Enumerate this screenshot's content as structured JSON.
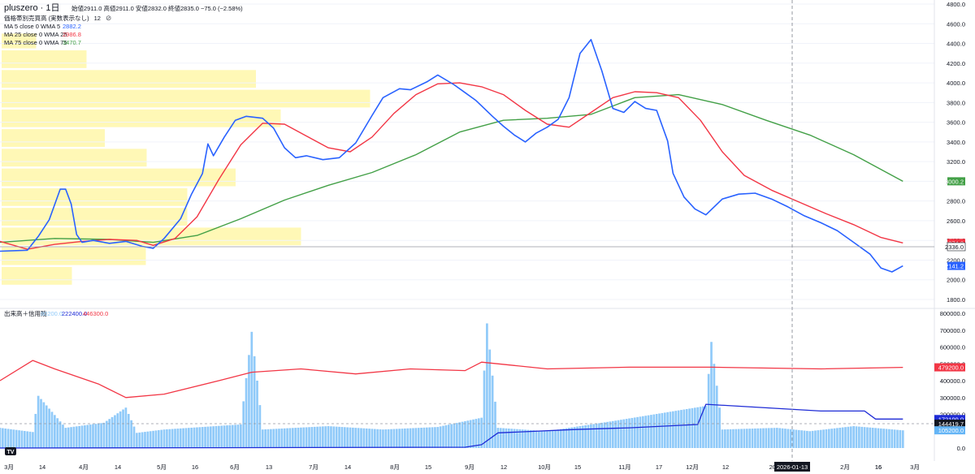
{
  "header": {
    "symbol": "pluszero",
    "interval": "1日",
    "ohlc": "始値2911.0 高値2911.0 安値2832.0 終値2835.0 −75.0 (−2.58%)",
    "indicator_vp": "価格帯別売買高 (実数表示なし)",
    "indicator_vp_value": "12",
    "ma_lines": [
      {
        "label": "MA 5 close 0 WMA 5",
        "value": "2882.2",
        "color": "#2962ff"
      },
      {
        "label": "MA 25 close 0 WMA 25",
        "value": "2986.8",
        "color": "#f23645"
      },
      {
        "label": "MA 75 close 0 WMA 75",
        "value": "3470.7",
        "color": "#43a047"
      }
    ],
    "volume_panel": {
      "label": "出来高＋信用残",
      "values": [
        {
          "value": "80200.0",
          "color": "#90caf9"
        },
        {
          "value": "222400.0",
          "color": "#1e2bd6"
        },
        {
          "value": "446300.0",
          "color": "#f23645"
        }
      ]
    }
  },
  "price_axis": {
    "ticks": [
      "4800.0",
      "4600.0",
      "4400.0",
      "4200.0",
      "4000.0",
      "3800.0",
      "3600.0",
      "3400.0",
      "3200.0",
      "3000.0",
      "2800.0",
      "2600.0",
      "2400.0",
      "2200.0",
      "2000.0",
      "1800.0"
    ],
    "tags": [
      {
        "text": "3000.2",
        "value": 3000.2,
        "color": "#43a047"
      },
      {
        "text": "2374.8",
        "value": 2374.8,
        "color": "#f23645"
      },
      {
        "text": "2336.0",
        "value": 2336.0,
        "color": "#ffffff",
        "text_color": "#131722",
        "border": "#131722"
      },
      {
        "text": "2141.2",
        "value": 2141.2,
        "color": "#2962ff"
      }
    ]
  },
  "volume_axis": {
    "ticks": [
      "800000.0",
      "700000.0",
      "600000.0",
      "500000.0",
      "400000.0",
      "300000.0",
      "200000.0",
      "100000.0",
      "0.0"
    ],
    "tags": [
      {
        "text": "479200.0",
        "value": 479200,
        "color": "#f23645"
      },
      {
        "text": "172100.0",
        "value": 172100,
        "color": "#1e2bd6"
      },
      {
        "text": "144419.7",
        "value": 144419.7,
        "color": "#131722"
      },
      {
        "text": "105200.0",
        "value": 105200,
        "color": "#64b5f6"
      }
    ]
  },
  "time_axis": {
    "labels": [
      "3月",
      "14",
      "4月",
      "14",
      "5月",
      "16",
      "6月",
      "13",
      "7月",
      "14",
      "8月",
      "15",
      "9月",
      "12",
      "10月",
      "15",
      "11月",
      "17",
      "12月",
      "12",
      "2026",
      "16",
      "2月",
      "16",
      "3月"
    ],
    "crosshair_label": "2026-01-13"
  },
  "volume_profile": [
    {
      "price_low": 4350,
      "price_high": 4500,
      "volume_pct": 8.5
    },
    {
      "price_low": 4150,
      "price_high": 4330,
      "volume_pct": 20.9
    },
    {
      "price_low": 3950,
      "price_high": 4130,
      "volume_pct": 62.6
    },
    {
      "price_low": 3750,
      "price_high": 3930,
      "volume_pct": 90.7
    },
    {
      "price_low": 3550,
      "price_high": 3730,
      "volume_pct": 68.7
    },
    {
      "price_low": 3350,
      "price_high": 3530,
      "volume_pct": 25.4
    },
    {
      "price_low": 3150,
      "price_high": 3330,
      "volume_pct": 35.7
    },
    {
      "price_low": 2950,
      "price_high": 3130,
      "volume_pct": 57.6
    },
    {
      "price_low": 2750,
      "price_high": 2930,
      "volume_pct": 45.7
    },
    {
      "price_low": 2550,
      "price_high": 2730,
      "volume_pct": 45.7
    },
    {
      "price_low": 2350,
      "price_high": 2530,
      "volume_pct": 73.7
    },
    {
      "price_low": 2150,
      "price_high": 2330,
      "volume_pct": 35.5
    },
    {
      "price_low": 1950,
      "price_high": 2130,
      "volume_pct": 17.3
    }
  ],
  "chart_data": {
    "type": "line",
    "price_scale": {
      "min": 1800,
      "max": 4800
    },
    "volume_scale": {
      "min": 0,
      "max": 800000
    },
    "x_range": [
      0,
      240
    ],
    "ma5_points": [
      [
        0,
        2290
      ],
      [
        10,
        2300
      ],
      [
        14,
        2440
      ],
      [
        18,
        2610
      ],
      [
        22,
        2920
      ],
      [
        24,
        2920
      ],
      [
        26,
        2770
      ],
      [
        28,
        2460
      ],
      [
        30,
        2380
      ],
      [
        34,
        2400
      ],
      [
        40,
        2370
      ],
      [
        46,
        2390
      ],
      [
        52,
        2340
      ],
      [
        56,
        2320
      ],
      [
        60,
        2420
      ],
      [
        66,
        2620
      ],
      [
        70,
        2870
      ],
      [
        74,
        3080
      ],
      [
        76,
        3380
      ],
      [
        78,
        3260
      ],
      [
        82,
        3450
      ],
      [
        86,
        3620
      ],
      [
        90,
        3660
      ],
      [
        96,
        3640
      ],
      [
        100,
        3540
      ],
      [
        104,
        3340
      ],
      [
        108,
        3240
      ],
      [
        112,
        3260
      ],
      [
        118,
        3220
      ],
      [
        124,
        3240
      ],
      [
        130,
        3390
      ],
      [
        136,
        3670
      ],
      [
        140,
        3850
      ],
      [
        146,
        3940
      ],
      [
        150,
        3930
      ],
      [
        156,
        4010
      ],
      [
        160,
        4080
      ],
      [
        166,
        3980
      ],
      [
        170,
        3900
      ],
      [
        174,
        3820
      ],
      [
        180,
        3660
      ],
      [
        184,
        3560
      ],
      [
        188,
        3470
      ],
      [
        192,
        3400
      ],
      [
        196,
        3490
      ],
      [
        200,
        3550
      ],
      [
        204,
        3630
      ],
      [
        208,
        3850
      ],
      [
        212,
        4300
      ],
      [
        216,
        4440
      ],
      [
        220,
        4120
      ],
      [
        224,
        3740
      ],
      [
        228,
        3700
      ],
      [
        232,
        3810
      ],
      [
        236,
        3740
      ],
      [
        240,
        3720
      ],
      [
        244,
        3410
      ],
      [
        246,
        3080
      ],
      [
        250,
        2840
      ],
      [
        254,
        2720
      ],
      [
        258,
        2660
      ],
      [
        264,
        2820
      ],
      [
        270,
        2870
      ],
      [
        276,
        2880
      ],
      [
        282,
        2820
      ],
      [
        288,
        2740
      ],
      [
        294,
        2650
      ],
      [
        300,
        2580
      ],
      [
        306,
        2500
      ],
      [
        312,
        2380
      ],
      [
        318,
        2260
      ],
      [
        322,
        2120
      ],
      [
        326,
        2080
      ],
      [
        330,
        2141
      ]
    ],
    "ma25_points": [
      [
        0,
        2390
      ],
      [
        10,
        2310
      ],
      [
        20,
        2360
      ],
      [
        30,
        2390
      ],
      [
        40,
        2410
      ],
      [
        50,
        2400
      ],
      [
        56,
        2350
      ],
      [
        64,
        2420
      ],
      [
        72,
        2640
      ],
      [
        80,
        3020
      ],
      [
        88,
        3370
      ],
      [
        96,
        3590
      ],
      [
        104,
        3580
      ],
      [
        112,
        3460
      ],
      [
        120,
        3340
      ],
      [
        128,
        3300
      ],
      [
        136,
        3450
      ],
      [
        144,
        3690
      ],
      [
        152,
        3880
      ],
      [
        160,
        3990
      ],
      [
        168,
        4000
      ],
      [
        176,
        3960
      ],
      [
        184,
        3880
      ],
      [
        192,
        3720
      ],
      [
        200,
        3580
      ],
      [
        208,
        3550
      ],
      [
        216,
        3700
      ],
      [
        224,
        3850
      ],
      [
        232,
        3910
      ],
      [
        240,
        3900
      ],
      [
        248,
        3850
      ],
      [
        256,
        3620
      ],
      [
        264,
        3300
      ],
      [
        272,
        3060
      ],
      [
        282,
        2910
      ],
      [
        292,
        2790
      ],
      [
        302,
        2670
      ],
      [
        312,
        2560
      ],
      [
        322,
        2430
      ],
      [
        330,
        2374.8
      ]
    ],
    "ma75_points": [
      [
        0,
        2380
      ],
      [
        20,
        2420
      ],
      [
        40,
        2410
      ],
      [
        56,
        2380
      ],
      [
        72,
        2450
      ],
      [
        88,
        2620
      ],
      [
        104,
        2810
      ],
      [
        120,
        2960
      ],
      [
        136,
        3090
      ],
      [
        152,
        3270
      ],
      [
        168,
        3500
      ],
      [
        184,
        3620
      ],
      [
        200,
        3640
      ],
      [
        216,
        3680
      ],
      [
        232,
        3850
      ],
      [
        248,
        3880
      ],
      [
        264,
        3780
      ],
      [
        280,
        3620
      ],
      [
        296,
        3470
      ],
      [
        312,
        3270
      ],
      [
        330,
        3000.2
      ]
    ],
    "volume_points": [
      [
        0,
        120000
      ],
      [
        12,
        95000
      ],
      [
        14,
        310000
      ],
      [
        24,
        120000
      ],
      [
        38,
        150000
      ],
      [
        46,
        240000
      ],
      [
        50,
        90000
      ],
      [
        60,
        110000
      ],
      [
        88,
        140000
      ],
      [
        92,
        690000
      ],
      [
        96,
        110000
      ],
      [
        120,
        130000
      ],
      [
        140,
        110000
      ],
      [
        160,
        125000
      ],
      [
        176,
        180000
      ],
      [
        178,
        740000
      ],
      [
        182,
        120000
      ],
      [
        200,
        100000
      ],
      [
        224,
        160000
      ],
      [
        258,
        250000
      ],
      [
        260,
        630000
      ],
      [
        264,
        110000
      ],
      [
        284,
        120000
      ],
      [
        296,
        100000
      ],
      [
        312,
        130000
      ],
      [
        330,
        105200
      ]
    ],
    "margin_buy_points": [
      [
        0,
        400000
      ],
      [
        12,
        520000
      ],
      [
        20,
        470000
      ],
      [
        36,
        380000
      ],
      [
        46,
        300000
      ],
      [
        60,
        320000
      ],
      [
        80,
        400000
      ],
      [
        92,
        450000
      ],
      [
        110,
        470000
      ],
      [
        130,
        440000
      ],
      [
        150,
        470000
      ],
      [
        170,
        460000
      ],
      [
        176,
        510000
      ],
      [
        188,
        490000
      ],
      [
        200,
        470000
      ],
      [
        230,
        480000
      ],
      [
        260,
        480000
      ],
      [
        300,
        470000
      ],
      [
        330,
        479200
      ]
    ],
    "margin_sell_points": [
      [
        0,
        0
      ],
      [
        80,
        2000
      ],
      [
        170,
        5000
      ],
      [
        176,
        20000
      ],
      [
        182,
        90000
      ],
      [
        210,
        110000
      ],
      [
        230,
        120000
      ],
      [
        255,
        140000
      ],
      [
        258,
        260000
      ],
      [
        300,
        220000
      ],
      [
        316,
        220000
      ],
      [
        320,
        172100
      ],
      [
        330,
        172100
      ]
    ],
    "current_price": 2336.0,
    "title": "",
    "xlabel": "",
    "ylabel": ""
  }
}
